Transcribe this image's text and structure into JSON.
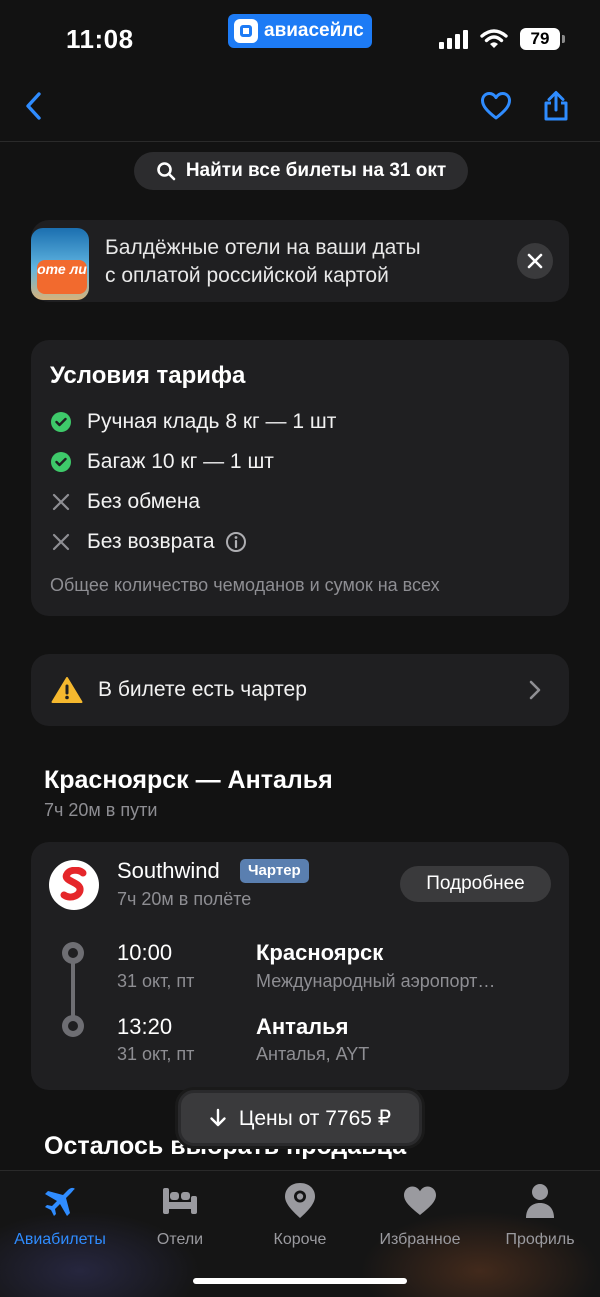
{
  "status_bar": {
    "time": "11:08",
    "brand": "авиасейлс",
    "battery": "79"
  },
  "search_chip": {
    "label": "Найти все билеты на 31 окт"
  },
  "promo": {
    "logo_text": "оте ли",
    "line1": "Балдёжные отели на ваши даты",
    "line2": "с оплатой российской картой"
  },
  "tariff": {
    "title": "Условия тарифа",
    "items": [
      {
        "label": "Ручная кладь 8 кг — 1 шт",
        "included": true
      },
      {
        "label": "Багаж 10 кг — 1 шт",
        "included": true
      },
      {
        "label": "Без обмена",
        "included": false
      },
      {
        "label": "Без возврата",
        "included": false
      }
    ],
    "note": "Общее количество чемоданов и сумок на всех"
  },
  "charter_notice": {
    "label": "В билете есть чартер"
  },
  "route": {
    "title": "Красноярск — Анталья",
    "duration": "7ч 20м в пути"
  },
  "flight": {
    "airline": "Southwind",
    "badge": "Чартер",
    "flight_time": "7ч 20м в полёте",
    "details_button": "Подробнее",
    "departure": {
      "time": "10:00",
      "date": "31 окт, пт",
      "city": "Красноярск",
      "airport": "Международный аэропорт…"
    },
    "arrival": {
      "time": "13:20",
      "date": "31 окт, пт",
      "city": "Анталья",
      "airport": "Анталья, AYT"
    }
  },
  "next_section": {
    "title": "Осталось выбрать продавца"
  },
  "price_pill": {
    "label": "Цены от 7765 ₽"
  },
  "tabs": [
    {
      "label": "Авиабилеты",
      "icon": "plane-icon",
      "active": true
    },
    {
      "label": "Отели",
      "icon": "bed-icon",
      "active": false
    },
    {
      "label": "Короче",
      "icon": "camera-pin-icon",
      "active": false
    },
    {
      "label": "Избранное",
      "icon": "heart-icon",
      "active": false
    },
    {
      "label": "Профиль",
      "icon": "person-icon",
      "active": false
    }
  ],
  "colors": {
    "accent": "#2f8cff",
    "background": "#121212",
    "card": "#1f1f21",
    "success": "#3ec96a",
    "warning": "#f5b82e",
    "brand": "#1d7bf5"
  }
}
